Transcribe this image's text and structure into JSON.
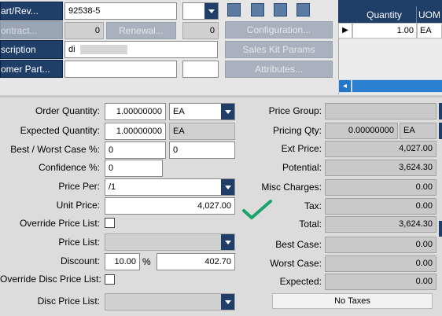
{
  "header": {
    "part_rev_label": "art/Rev...",
    "part_value": "92538-5",
    "contract_label": "ontract...",
    "contract_value": "0",
    "renewal_label": "Renewal...",
    "renewal_value": "0",
    "configuration_label": "Configuration...",
    "description_label": "scription",
    "description_value": "di",
    "sales_kit_label": "Sales Kit Params",
    "customer_part_label": "omer Part...",
    "attributes_label": "Attributes..."
  },
  "grid": {
    "columns": [
      "Quantity",
      "UOM"
    ],
    "rows": [
      {
        "quantity": "1.00",
        "uom": "EA"
      }
    ],
    "row_marker": "▶",
    "scroll_left": "◂"
  },
  "left_form": {
    "order_qty_label": "Order Quantity:",
    "order_qty_value": "1.00000000",
    "order_qty_uom": "EA",
    "expected_qty_label": "Expected Quantity:",
    "expected_qty_value": "1.00000000",
    "expected_qty_uom": "EA",
    "best_worst_label": "Best / Worst Case %:",
    "best_value": "0",
    "worst_value": "0",
    "confidence_label": "Confidence %:",
    "confidence_value": "0",
    "price_per_label": "Price Per:",
    "price_per_value": "/1",
    "unit_price_label": "Unit Price:",
    "unit_price_value": "4,027.00",
    "override_price_list_label": "Override Price List:",
    "price_list_label": "Price List:",
    "price_list_value": "",
    "discount_label": "Discount:",
    "discount_pct": "10.00",
    "discount_pct_symbol": "%",
    "discount_amount": "402.70",
    "override_disc_label": "Override Disc Price List:",
    "disc_price_list_label": "Disc Price List:",
    "disc_price_list_value": ""
  },
  "right_form": {
    "price_group_label": "Price Group:",
    "price_group_value": "",
    "pricing_qty_label": "Pricing Qty:",
    "pricing_qty_value": "0.00000000",
    "pricing_qty_uom": "EA",
    "ext_price_label": "Ext Price:",
    "ext_price_value": "4,027.00",
    "potential_label": "Potential:",
    "potential_value": "3,624.30",
    "misc_charges_label": "Misc Charges:",
    "misc_charges_value": "0.00",
    "tax_label": "Tax:",
    "tax_value": "0.00",
    "total_label": "Total:",
    "total_value": "3,624.30",
    "best_case_label": "Best Case:",
    "best_case_value": "0.00",
    "worst_case_label": "Worst Case:",
    "worst_case_value": "0.00",
    "expected_label": "Expected:",
    "expected_value": "0.00",
    "no_taxes_label": "No Taxes"
  },
  "colors": {
    "nav_blue": "#1f3e68",
    "checkmark_green": "#1aa36b"
  },
  "icons": [
    "toolbar-icon",
    "arrow-up-icon",
    "arrow-down-icon",
    "window-icon",
    "checkmark-icon"
  ]
}
